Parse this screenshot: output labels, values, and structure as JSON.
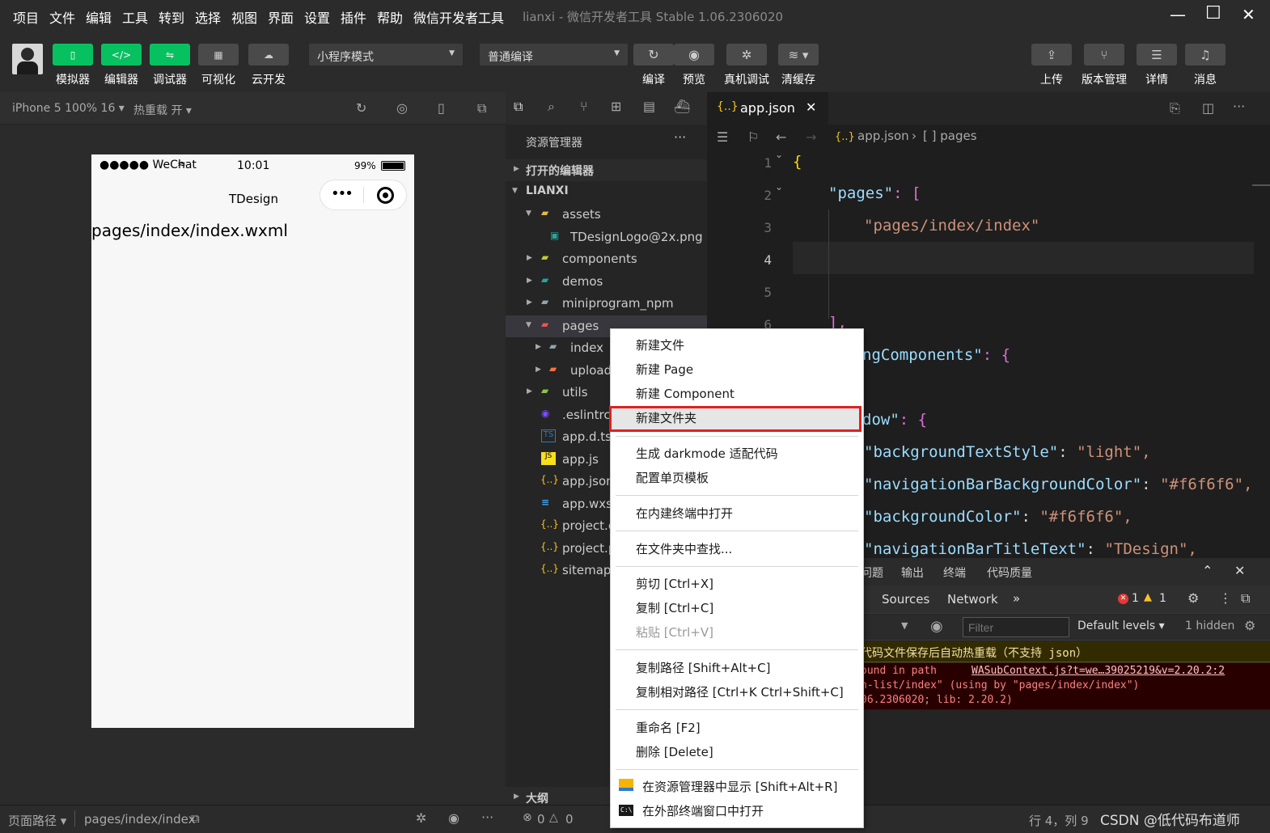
{
  "menu": {
    "items": [
      "项目",
      "文件",
      "编辑",
      "工具",
      "转到",
      "选择",
      "视图",
      "界面",
      "设置",
      "插件",
      "帮助",
      "微信开发者工具"
    ],
    "window_title": "lianxi - 微信开发者工具 Stable 1.06.2306020"
  },
  "toolbar": {
    "simulator": "模拟器",
    "editor": "编辑器",
    "debugger": "调试器",
    "visual": "可视化",
    "cloud": "云开发",
    "mode_select": "小程序模式",
    "compile_select": "普通编译",
    "compile": "编译",
    "preview": "预览",
    "real_debug": "真机调试",
    "clear_cache": "清缓存",
    "upload": "上传",
    "version": "版本管理",
    "details": "详情",
    "messages": "消息"
  },
  "simulator": {
    "device": "iPhone 5 100% 16",
    "hot_reload": "热重载 开",
    "status_carrier": "●●●●● WeChat",
    "status_time": "10:01",
    "status_battery": "99%",
    "nav_title": "TDesign",
    "content": "pages/index/index.wxml"
  },
  "explorer": {
    "title": "资源管理器",
    "open_editors": "打开的编辑器",
    "project": "LIANXI",
    "tree": [
      "assets",
      "TDesignLogo@2x.png",
      "components",
      "demos",
      "miniprogram_npm",
      "pages",
      "index",
      "upload",
      "utils",
      ".eslintrc",
      "app.d.ts",
      "app.js",
      "app.json",
      "app.wxss",
      "project.c",
      "project.p",
      "sitemap."
    ],
    "outline": "大纲"
  },
  "editor": {
    "tab": "app.json",
    "crumb_file": "app.json",
    "crumb_node": "[ ] pages",
    "line_numbers": [
      "1",
      "2",
      "3",
      "4",
      "5",
      "6"
    ],
    "code": {
      "l1": "{",
      "l2_key": "\"pages\"",
      "l2_rest": ": [",
      "l3": "\"pages/index/index\"",
      "l6": "],",
      "l7_key": "ngComponents\"",
      "l7_rest": ": {",
      "l9_key": "dow\"",
      "l9_rest": ": {",
      "l10_key": "\"backgroundTextStyle\"",
      "l10_val": "\"light\",",
      "l11_key": "\"navigationBarBackgroundColor\"",
      "l11_val": "\"#f6f6f6\",",
      "l12_key": "\"backgroundColor\"",
      "l12_val": "\"#f6f6f6\",",
      "l13_key": "\"navigationBarTitleText\"",
      "l13_val": "\"TDesign\","
    }
  },
  "console": {
    "tabs": [
      "问题",
      "输出",
      "终端",
      "代码质量"
    ],
    "devtabs": [
      "Sources",
      "Network"
    ],
    "errors": "1",
    "warnings": "1",
    "filter_placeholder": "Filter",
    "levels": "Default levels",
    "hidden": "1 hidden",
    "warn_line": "代码文件保存后自动热重载（不支持 json）",
    "err1": "ound in path",
    "err1_link": "WASubContext.js?t=we…39025219&v=2.20.2:2",
    "err2": "n-list/index\" (using by \"pages/index/index\")",
    "err3": "06.2306020; lib: 2.20.2)"
  },
  "context_menu": {
    "new_file": "新建文件",
    "new_page": "新建 Page",
    "new_component": "新建 Component",
    "new_folder": "新建文件夹",
    "darkmode": "生成 darkmode 适配代码",
    "page_template": "配置单页模板",
    "open_terminal": "在内建终端中打开",
    "find_in_folder": "在文件夹中查找...",
    "cut": "剪切  [Ctrl+X]",
    "copy": "复制  [Ctrl+C]",
    "paste": "粘贴  [Ctrl+V]",
    "copy_path": "复制路径  [Shift+Alt+C]",
    "copy_rel_path": "复制相对路径  [Ctrl+K Ctrl+Shift+C]",
    "rename": "重命名  [F2]",
    "delete": "删除  [Delete]",
    "reveal": "在资源管理器中显示  [Shift+Alt+R]",
    "open_external": "在外部终端窗口中打开"
  },
  "status": {
    "page_path_label": "页面路径",
    "page_path": "pages/index/index",
    "errors": "0",
    "warnings": "0",
    "cursor": "行 4，列 9",
    "watermark": "CSDN @低代码布道师"
  },
  "colors": {
    "accent_green": "#07c160",
    "highlight_red": "#e02020"
  }
}
